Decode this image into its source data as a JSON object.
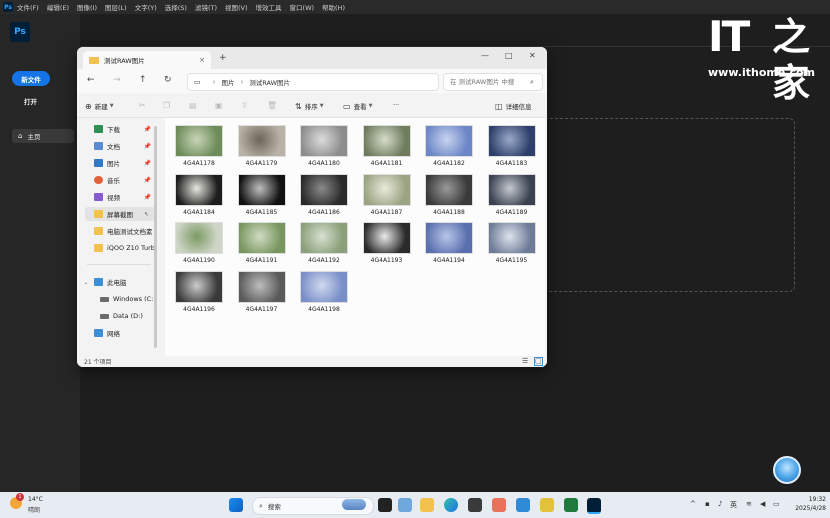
{
  "ps": {
    "menu": [
      "文件(F)",
      "编辑(E)",
      "图像(I)",
      "图层(L)",
      "文字(Y)",
      "选择(S)",
      "滤镜(T)",
      "视图(V)",
      "增效工具",
      "窗口(W)",
      "帮助(H)"
    ],
    "logo": "Ps",
    "new_file": "新文件",
    "open": "打开",
    "home": "主页"
  },
  "watermark": {
    "it": "IT",
    "glyph": "之家",
    "url": "www.ithome.com"
  },
  "explorer": {
    "tab_title": "测试RAW图片",
    "tab_close": "×",
    "new_tab": "+",
    "window_controls": {
      "min": "—",
      "max": "□",
      "close": "✕"
    },
    "breadcrumb": [
      "图片",
      "测试RAW图片"
    ],
    "search_placeholder": "在 测试RAW图片 中搜",
    "toolbar": {
      "new": "新建",
      "sort": "排序",
      "view": "查看",
      "more": "···",
      "details": "详细信息"
    },
    "nav": {
      "downloads": "下载",
      "documents": "文档",
      "pictures": "图片",
      "music": "音乐",
      "videos": "视频",
      "screenshots": "屏幕截图",
      "folder_test": "电脑测试文档素",
      "folder_iqoo": "iQOO Z10 Turb",
      "this_pc": "此电脑",
      "drive_c": "Windows (C:)",
      "drive_d": "Data (D:)",
      "network": "网络"
    },
    "files": [
      "4G4A1178",
      "4G4A1179",
      "4G4A1180",
      "4G4A1181",
      "4G4A1182",
      "4G4A1183",
      "4G4A1184",
      "4G4A1185",
      "4G4A1186",
      "4G4A1187",
      "4G4A1188",
      "4G4A1189",
      "4G4A1190",
      "4G4A1191",
      "4G4A1192",
      "4G4A1193",
      "4G4A1194",
      "4G4A1195",
      "4G4A1196",
      "4G4A1197",
      "4G4A1198"
    ],
    "status": "21 个项目"
  },
  "taskbar": {
    "weather_temp": "14°C",
    "weather_desc": "晴朗",
    "weather_badge": "1",
    "search": "搜索",
    "ime": "英",
    "time": "19:32",
    "date": "2025/4/28"
  }
}
